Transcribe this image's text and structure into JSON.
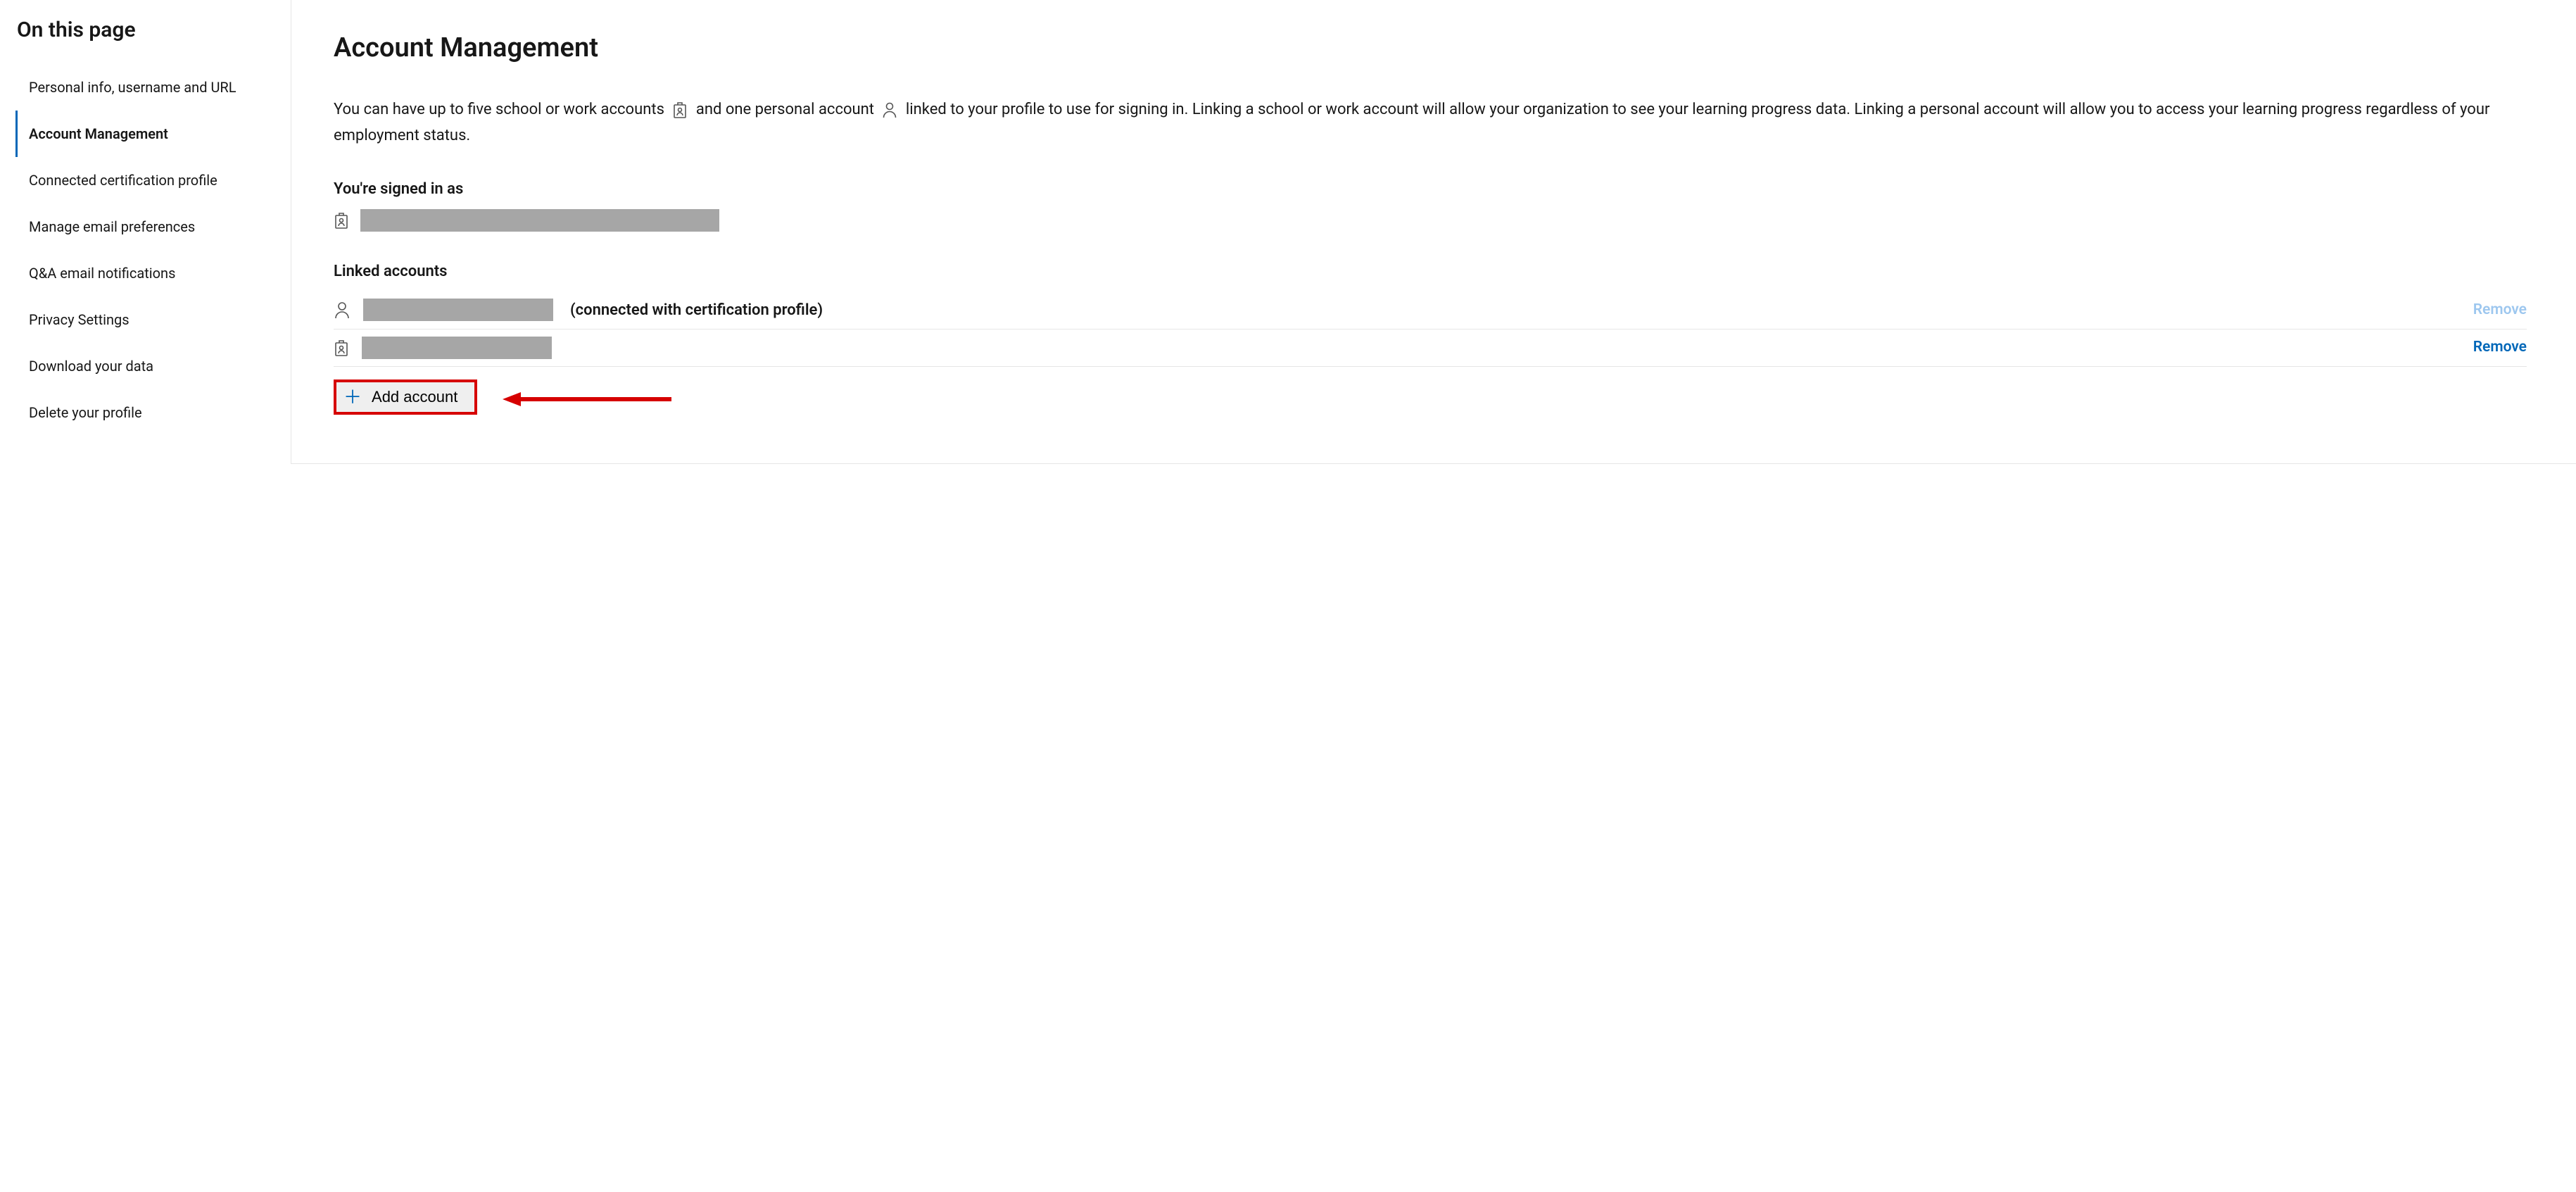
{
  "sidebar": {
    "title": "On this page",
    "items": [
      {
        "label": "Personal info, username and URL",
        "active": false
      },
      {
        "label": "Account Management",
        "active": true
      },
      {
        "label": "Connected certification profile",
        "active": false
      },
      {
        "label": "Manage email preferences",
        "active": false
      },
      {
        "label": "Q&A email notifications",
        "active": false
      },
      {
        "label": "Privacy Settings",
        "active": false
      },
      {
        "label": "Download your data",
        "active": false
      },
      {
        "label": "Delete your profile",
        "active": false
      }
    ]
  },
  "main": {
    "title": "Account Management",
    "desc_part1": "You can have up to five school or work accounts",
    "desc_part2": "and one personal account",
    "desc_part3": "linked to your profile to use for signing in. Linking a school or work account will allow your organization to see your learning progress data. Linking a personal account will allow you to access your learning progress regardless of your employment status.",
    "signed_in_heading": "You're signed in as",
    "linked_heading": "Linked accounts",
    "linked": [
      {
        "note": "(connected with certification profile)",
        "remove": "Remove",
        "removable": false,
        "type": "personal"
      },
      {
        "note": "",
        "remove": "Remove",
        "removable": true,
        "type": "work"
      }
    ],
    "add_account_label": "Add account"
  }
}
